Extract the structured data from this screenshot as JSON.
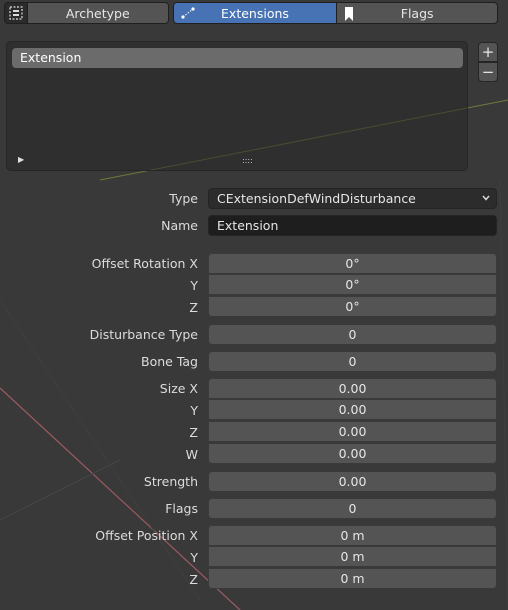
{
  "tabs": {
    "archetype_label": "Archetype",
    "extensions_label": "Extensions",
    "flags_label": "Flags"
  },
  "extension_list": {
    "items": [
      "Extension"
    ]
  },
  "properties": {
    "type": {
      "label": "Type",
      "value": "CExtensionDefWindDisturbance"
    },
    "name": {
      "label": "Name",
      "value": "Extension"
    },
    "offset_rotation": {
      "x_label": "Offset Rotation X",
      "x": "0°",
      "y_label": "Y",
      "y": "0°",
      "z_label": "Z",
      "z": "0°"
    },
    "disturbance_type": {
      "label": "Disturbance Type",
      "value": "0"
    },
    "bone_tag": {
      "label": "Bone Tag",
      "value": "0"
    },
    "size": {
      "x_label": "Size X",
      "x": "0.00",
      "y_label": "Y",
      "y": "0.00",
      "z_label": "Z",
      "z": "0.00",
      "w_label": "W",
      "w": "0.00"
    },
    "strength": {
      "label": "Strength",
      "value": "0.00"
    },
    "flags": {
      "label": "Flags",
      "value": "0"
    },
    "offset_position": {
      "x_label": "Offset Position X",
      "x": "0 m",
      "y_label": "Y",
      "y": "0 m",
      "z_label": "Z",
      "z": "0 m"
    }
  },
  "colors": {
    "active_tab": "#4772b3",
    "field_bg": "#545454",
    "panel_bg": "#393939"
  }
}
